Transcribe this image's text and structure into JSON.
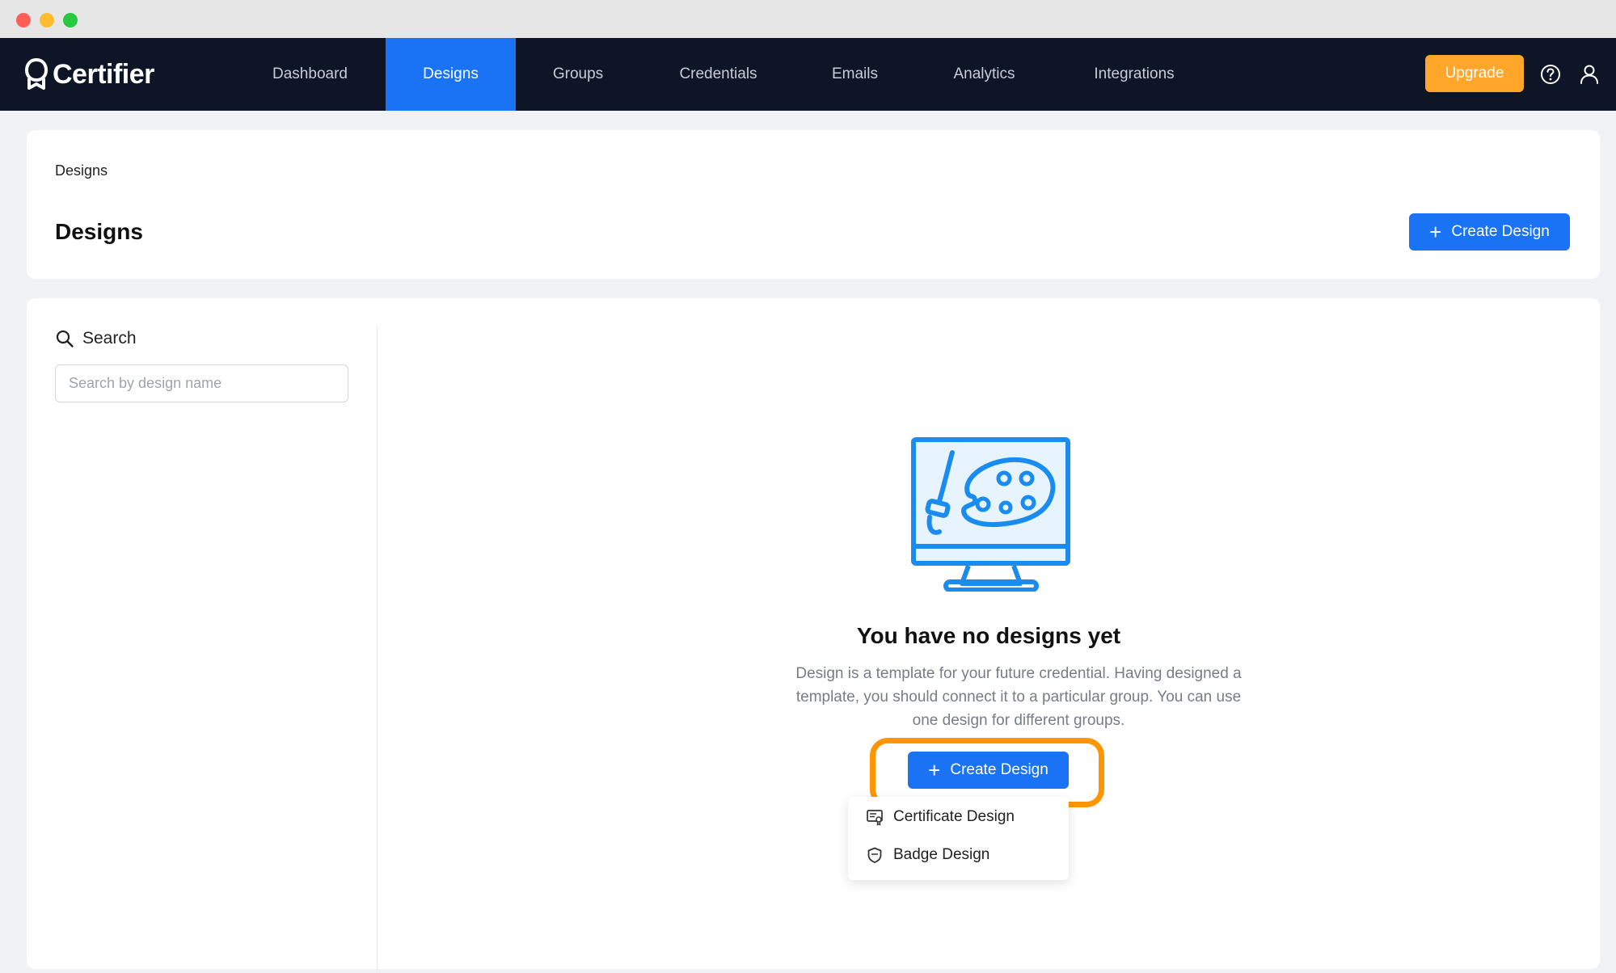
{
  "window": {
    "controls": [
      "close",
      "minimize",
      "zoom"
    ]
  },
  "navbar": {
    "logo_text": "Certifier",
    "items": [
      {
        "label": "Dashboard",
        "active": false
      },
      {
        "label": "Designs",
        "active": true
      },
      {
        "label": "Groups",
        "active": false
      },
      {
        "label": "Credentials",
        "active": false
      },
      {
        "label": "Emails",
        "active": false
      },
      {
        "label": "Analytics",
        "active": false
      },
      {
        "label": "Integrations",
        "active": false
      }
    ],
    "upgrade_label": "Upgrade",
    "icons": [
      "help-circle-icon",
      "user-icon"
    ]
  },
  "header": {
    "breadcrumb": "Designs",
    "title": "Designs",
    "create_button_label": "Create Design"
  },
  "sidebar": {
    "search_label": "Search",
    "search_placeholder": "Search by design name",
    "search_value": ""
  },
  "empty_state": {
    "icon": "monitor-palette-icon",
    "title": "You have no designs yet",
    "description": "Design is a template for your future credential. Having designed a template, you should connect it to a particular group. You can use one design for different groups.",
    "create_button_label": "Create Design"
  },
  "dropdown": {
    "items": [
      {
        "label": "Certificate Design",
        "icon": "certificate-icon"
      },
      {
        "label": "Badge Design",
        "icon": "badge-shield-icon"
      }
    ]
  },
  "colors": {
    "nav_bg": "#0d1526",
    "accent": "#1a73f5",
    "upgrade": "#ffa62b",
    "highlight": "#ff9500"
  }
}
